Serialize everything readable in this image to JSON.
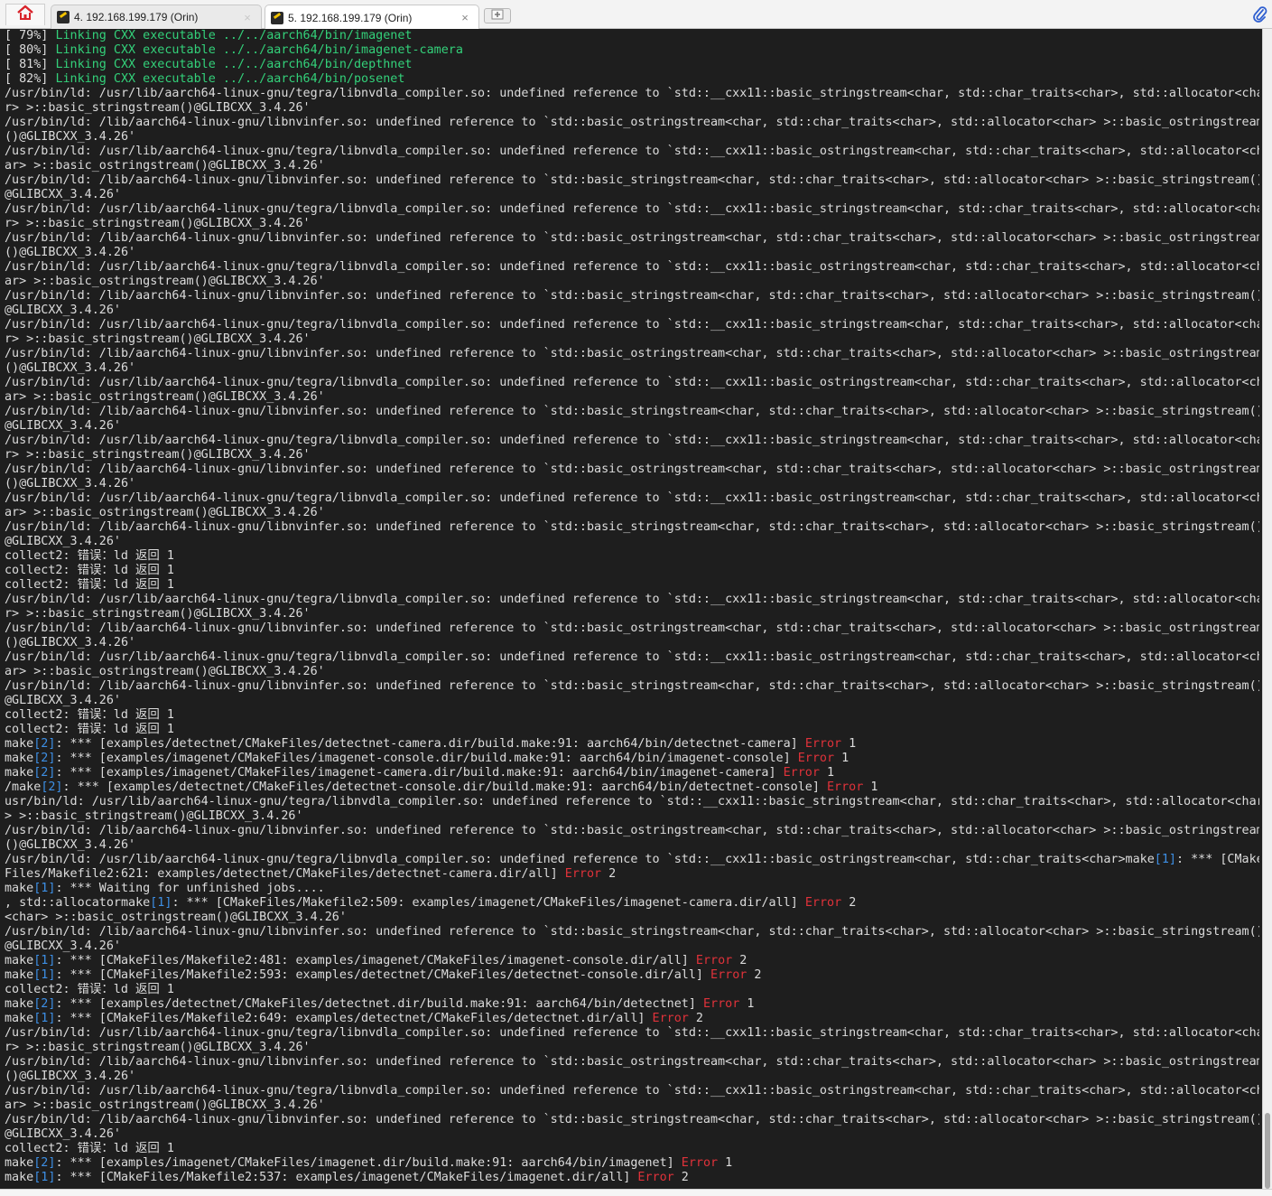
{
  "tabs": [
    {
      "label": "4. 192.168.199.179 (Orin)",
      "close": "×",
      "active": false
    },
    {
      "label": "5. 192.168.199.179 (Orin)",
      "close": "×",
      "active": true
    }
  ],
  "icons": {
    "home": "home-icon",
    "tab": "terminal-icon",
    "new_tab": "add-tab-icon",
    "attach": "paperclip-icon"
  },
  "colors": {
    "terminal_bg": "#1e1e1e",
    "text": "#dcdcdc",
    "green": "#33d17a",
    "red": "#e0323a",
    "blue": "#3d8fe5"
  },
  "terminal": {
    "lines": [
      [
        [
          "[ 79%] "
        ],
        [
          "Linking CXX executable ../../aarch64/bin/imagenet",
          "g"
        ]
      ],
      [
        [
          "[ 80%] "
        ],
        [
          "Linking CXX executable ../../aarch64/bin/imagenet-camera",
          "g"
        ]
      ],
      [
        [
          "[ 81%] "
        ],
        [
          "Linking CXX executable ../../aarch64/bin/depthnet",
          "g"
        ]
      ],
      [
        [
          "[ 82%] "
        ],
        [
          "Linking CXX executable ../../aarch64/bin/posenet",
          "g"
        ]
      ],
      [
        [
          "/usr/bin/ld: /usr/lib/aarch64-linux-gnu/tegra/libnvdla_compiler.so: undefined reference to `std::__cxx11::basic_stringstream<char, std::char_traits<char>, std::allocator<cha"
        ]
      ],
      [
        [
          "r> >::basic_stringstream()@GLIBCXX_3.4.26'"
        ]
      ],
      [
        [
          "/usr/bin/ld: /lib/aarch64-linux-gnu/libnvinfer.so: undefined reference to `std::basic_ostringstream<char, std::char_traits<char>, std::allocator<char> >::basic_ostringstream"
        ]
      ],
      [
        [
          "()@GLIBCXX_3.4.26'"
        ]
      ],
      [
        [
          "/usr/bin/ld: /usr/lib/aarch64-linux-gnu/tegra/libnvdla_compiler.so: undefined reference to `std::__cxx11::basic_ostringstream<char, std::char_traits<char>, std::allocator<ch"
        ]
      ],
      [
        [
          "ar> >::basic_ostringstream()@GLIBCXX_3.4.26'"
        ]
      ],
      [
        [
          "/usr/bin/ld: /lib/aarch64-linux-gnu/libnvinfer.so: undefined reference to `std::basic_stringstream<char, std::char_traits<char>, std::allocator<char> >::basic_stringstream()"
        ]
      ],
      [
        [
          "@GLIBCXX_3.4.26'"
        ]
      ],
      [
        [
          "/usr/bin/ld: /usr/lib/aarch64-linux-gnu/tegra/libnvdla_compiler.so: undefined reference to `std::__cxx11::basic_stringstream<char, std::char_traits<char>, std::allocator<cha"
        ]
      ],
      [
        [
          "r> >::basic_stringstream()@GLIBCXX_3.4.26'"
        ]
      ],
      [
        [
          "/usr/bin/ld: /lib/aarch64-linux-gnu/libnvinfer.so: undefined reference to `std::basic_ostringstream<char, std::char_traits<char>, std::allocator<char> >::basic_ostringstream"
        ]
      ],
      [
        [
          "()@GLIBCXX_3.4.26'"
        ]
      ],
      [
        [
          "/usr/bin/ld: /usr/lib/aarch64-linux-gnu/tegra/libnvdla_compiler.so: undefined reference to `std::__cxx11::basic_ostringstream<char, std::char_traits<char>, std::allocator<ch"
        ]
      ],
      [
        [
          "ar> >::basic_ostringstream()@GLIBCXX_3.4.26'"
        ]
      ],
      [
        [
          "/usr/bin/ld: /lib/aarch64-linux-gnu/libnvinfer.so: undefined reference to `std::basic_stringstream<char, std::char_traits<char>, std::allocator<char> >::basic_stringstream()"
        ]
      ],
      [
        [
          "@GLIBCXX_3.4.26'"
        ]
      ],
      [
        [
          "/usr/bin/ld: /usr/lib/aarch64-linux-gnu/tegra/libnvdla_compiler.so: undefined reference to `std::__cxx11::basic_stringstream<char, std::char_traits<char>, std::allocator<cha"
        ]
      ],
      [
        [
          "r> >::basic_stringstream()@GLIBCXX_3.4.26'"
        ]
      ],
      [
        [
          "/usr/bin/ld: /lib/aarch64-linux-gnu/libnvinfer.so: undefined reference to `std::basic_ostringstream<char, std::char_traits<char>, std::allocator<char> >::basic_ostringstream"
        ]
      ],
      [
        [
          "()@GLIBCXX_3.4.26'"
        ]
      ],
      [
        [
          "/usr/bin/ld: /usr/lib/aarch64-linux-gnu/tegra/libnvdla_compiler.so: undefined reference to `std::__cxx11::basic_ostringstream<char, std::char_traits<char>, std::allocator<ch"
        ]
      ],
      [
        [
          "ar> >::basic_ostringstream()@GLIBCXX_3.4.26'"
        ]
      ],
      [
        [
          "/usr/bin/ld: /lib/aarch64-linux-gnu/libnvinfer.so: undefined reference to `std::basic_stringstream<char, std::char_traits<char>, std::allocator<char> >::basic_stringstream()"
        ]
      ],
      [
        [
          "@GLIBCXX_3.4.26'"
        ]
      ],
      [
        [
          "/usr/bin/ld: /usr/lib/aarch64-linux-gnu/tegra/libnvdla_compiler.so: undefined reference to `std::__cxx11::basic_stringstream<char, std::char_traits<char>, std::allocator<cha"
        ]
      ],
      [
        [
          "r> >::basic_stringstream()@GLIBCXX_3.4.26'"
        ]
      ],
      [
        [
          "/usr/bin/ld: /lib/aarch64-linux-gnu/libnvinfer.so: undefined reference to `std::basic_ostringstream<char, std::char_traits<char>, std::allocator<char> >::basic_ostringstream"
        ]
      ],
      [
        [
          "()@GLIBCXX_3.4.26'"
        ]
      ],
      [
        [
          "/usr/bin/ld: /usr/lib/aarch64-linux-gnu/tegra/libnvdla_compiler.so: undefined reference to `std::__cxx11::basic_ostringstream<char, std::char_traits<char>, std::allocator<ch"
        ]
      ],
      [
        [
          "ar> >::basic_ostringstream()@GLIBCXX_3.4.26'"
        ]
      ],
      [
        [
          "/usr/bin/ld: /lib/aarch64-linux-gnu/libnvinfer.so: undefined reference to `std::basic_stringstream<char, std::char_traits<char>, std::allocator<char> >::basic_stringstream()"
        ]
      ],
      [
        [
          "@GLIBCXX_3.4.26'"
        ]
      ],
      [
        [
          "collect2: 错误：ld 返回 1"
        ]
      ],
      [
        [
          "collect2: 错误：ld 返回 1"
        ]
      ],
      [
        [
          "collect2: 错误：ld 返回 1"
        ]
      ],
      [
        [
          "/usr/bin/ld: /usr/lib/aarch64-linux-gnu/tegra/libnvdla_compiler.so: undefined reference to `std::__cxx11::basic_stringstream<char, std::char_traits<char>, std::allocator<cha"
        ]
      ],
      [
        [
          "r> >::basic_stringstream()@GLIBCXX_3.4.26'"
        ]
      ],
      [
        [
          "/usr/bin/ld: /lib/aarch64-linux-gnu/libnvinfer.so: undefined reference to `std::basic_ostringstream<char, std::char_traits<char>, std::allocator<char> >::basic_ostringstream"
        ]
      ],
      [
        [
          "()@GLIBCXX_3.4.26'"
        ]
      ],
      [
        [
          "/usr/bin/ld: /usr/lib/aarch64-linux-gnu/tegra/libnvdla_compiler.so: undefined reference to `std::__cxx11::basic_ostringstream<char, std::char_traits<char>, std::allocator<ch"
        ]
      ],
      [
        [
          "ar> >::basic_ostringstream()@GLIBCXX_3.4.26'"
        ]
      ],
      [
        [
          "/usr/bin/ld: /lib/aarch64-linux-gnu/libnvinfer.so: undefined reference to `std::basic_stringstream<char, std::char_traits<char>, std::allocator<char> >::basic_stringstream()"
        ]
      ],
      [
        [
          "@GLIBCXX_3.4.26'"
        ]
      ],
      [
        [
          "collect2: 错误：ld 返回 1"
        ]
      ],
      [
        [
          "collect2: 错误：ld 返回 1"
        ]
      ],
      [
        [
          "make"
        ],
        [
          "[2]",
          "b"
        ],
        [
          ": *** [examples/detectnet/CMakeFiles/detectnet-camera.dir/build.make:91: aarch64/bin/detectnet-camera] "
        ],
        [
          "Error",
          "r"
        ],
        [
          " 1"
        ]
      ],
      [
        [
          "make"
        ],
        [
          "[2]",
          "b"
        ],
        [
          ": *** [examples/imagenet/CMakeFiles/imagenet-console.dir/build.make:91: aarch64/bin/imagenet-console] "
        ],
        [
          "Error",
          "r"
        ],
        [
          " 1"
        ]
      ],
      [
        [
          "make"
        ],
        [
          "[2]",
          "b"
        ],
        [
          ": *** [examples/imagenet/CMakeFiles/imagenet-camera.dir/build.make:91: aarch64/bin/imagenet-camera] "
        ],
        [
          "Error",
          "r"
        ],
        [
          " 1"
        ]
      ],
      [
        [
          "/make"
        ],
        [
          "[2]",
          "b"
        ],
        [
          ": *** [examples/detectnet/CMakeFiles/detectnet-console.dir/build.make:91: aarch64/bin/detectnet-console] "
        ],
        [
          "Error",
          "r"
        ],
        [
          " 1"
        ]
      ],
      [
        [
          "usr/bin/ld: /usr/lib/aarch64-linux-gnu/tegra/libnvdla_compiler.so: undefined reference to `std::__cxx11::basic_stringstream<char, std::char_traits<char>, std::allocator<char"
        ]
      ],
      [
        [
          "> >::basic_stringstream()@GLIBCXX_3.4.26'"
        ]
      ],
      [
        [
          "/usr/bin/ld: /lib/aarch64-linux-gnu/libnvinfer.so: undefined reference to `std::basic_ostringstream<char, std::char_traits<char>, std::allocator<char> >::basic_ostringstream"
        ]
      ],
      [
        [
          "()@GLIBCXX_3.4.26'"
        ]
      ],
      [
        [
          "/usr/bin/ld: /usr/lib/aarch64-linux-gnu/tegra/libnvdla_compiler.so: undefined reference to `std::__cxx11::basic_ostringstream<char, std::char_traits<char>make"
        ],
        [
          "[1]",
          "b"
        ],
        [
          ": *** [CMake"
        ]
      ],
      [
        [
          "Files/Makefile2:621: examples/detectnet/CMakeFiles/detectnet-camera.dir/all] "
        ],
        [
          "Error",
          "r"
        ],
        [
          " 2"
        ]
      ],
      [
        [
          "make"
        ],
        [
          "[1]",
          "b"
        ],
        [
          ": *** Waiting for unfinished jobs...."
        ]
      ],
      [
        [
          ", std::allocatormake"
        ],
        [
          "[1]",
          "b"
        ],
        [
          ": *** [CMakeFiles/Makefile2:509: examples/imagenet/CMakeFiles/imagenet-camera.dir/all] "
        ],
        [
          "Error",
          "r"
        ],
        [
          " 2"
        ]
      ],
      [
        [
          "<char> >::basic_ostringstream()@GLIBCXX_3.4.26'"
        ]
      ],
      [
        [
          "/usr/bin/ld: /lib/aarch64-linux-gnu/libnvinfer.so: undefined reference to `std::basic_stringstream<char, std::char_traits<char>, std::allocator<char> >::basic_stringstream()"
        ]
      ],
      [
        [
          "@GLIBCXX_3.4.26'"
        ]
      ],
      [
        [
          "make"
        ],
        [
          "[1]",
          "b"
        ],
        [
          ": *** [CMakeFiles/Makefile2:481: examples/imagenet/CMakeFiles/imagenet-console.dir/all] "
        ],
        [
          "Error",
          "r"
        ],
        [
          " 2"
        ]
      ],
      [
        [
          "make"
        ],
        [
          "[1]",
          "b"
        ],
        [
          ": *** [CMakeFiles/Makefile2:593: examples/detectnet/CMakeFiles/detectnet-console.dir/all] "
        ],
        [
          "Error",
          "r"
        ],
        [
          " 2"
        ]
      ],
      [
        [
          "collect2: 错误：ld 返回 1"
        ]
      ],
      [
        [
          "make"
        ],
        [
          "[2]",
          "b"
        ],
        [
          ": *** [examples/detectnet/CMakeFiles/detectnet.dir/build.make:91: aarch64/bin/detectnet] "
        ],
        [
          "Error",
          "r"
        ],
        [
          " 1"
        ]
      ],
      [
        [
          "make"
        ],
        [
          "[1]",
          "b"
        ],
        [
          ": *** [CMakeFiles/Makefile2:649: examples/detectnet/CMakeFiles/detectnet.dir/all] "
        ],
        [
          "Error",
          "r"
        ],
        [
          " 2"
        ]
      ],
      [
        [
          "/usr/bin/ld: /usr/lib/aarch64-linux-gnu/tegra/libnvdla_compiler.so: undefined reference to `std::__cxx11::basic_stringstream<char, std::char_traits<char>, std::allocator<cha"
        ]
      ],
      [
        [
          "r> >::basic_stringstream()@GLIBCXX_3.4.26'"
        ]
      ],
      [
        [
          "/usr/bin/ld: /lib/aarch64-linux-gnu/libnvinfer.so: undefined reference to `std::basic_ostringstream<char, std::char_traits<char>, std::allocator<char> >::basic_ostringstream"
        ]
      ],
      [
        [
          "()@GLIBCXX_3.4.26'"
        ]
      ],
      [
        [
          "/usr/bin/ld: /usr/lib/aarch64-linux-gnu/tegra/libnvdla_compiler.so: undefined reference to `std::__cxx11::basic_ostringstream<char, std::char_traits<char>, std::allocator<ch"
        ]
      ],
      [
        [
          "ar> >::basic_ostringstream()@GLIBCXX_3.4.26'"
        ]
      ],
      [
        [
          "/usr/bin/ld: /lib/aarch64-linux-gnu/libnvinfer.so: undefined reference to `std::basic_stringstream<char, std::char_traits<char>, std::allocator<char> >::basic_stringstream()"
        ]
      ],
      [
        [
          "@GLIBCXX_3.4.26'"
        ]
      ],
      [
        [
          "collect2: 错误：ld 返回 1"
        ]
      ],
      [
        [
          "make"
        ],
        [
          "[2]",
          "b"
        ],
        [
          ": *** [examples/imagenet/CMakeFiles/imagenet.dir/build.make:91: aarch64/bin/imagenet] "
        ],
        [
          "Error",
          "r"
        ],
        [
          " 1"
        ]
      ],
      [
        [
          "make"
        ],
        [
          "[1]",
          "b"
        ],
        [
          ": *** [CMakeFiles/Makefile2:537: examples/imagenet/CMakeFiles/imagenet.dir/all] "
        ],
        [
          "Error",
          "r"
        ],
        [
          " 2"
        ]
      ]
    ]
  }
}
